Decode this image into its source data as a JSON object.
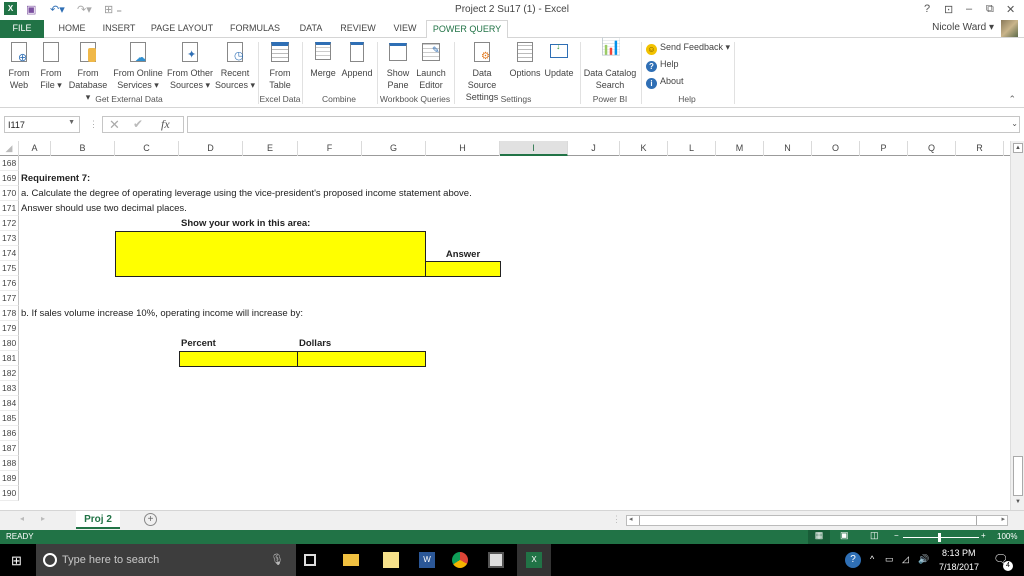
{
  "window": {
    "title": "Project 2 Su17 (1) - Excel",
    "user": "Nicole Ward",
    "controls": [
      "?",
      "ribbon-display",
      "minimize",
      "restore",
      "close"
    ]
  },
  "tabs": [
    {
      "label": "FILE"
    },
    {
      "label": "HOME"
    },
    {
      "label": "INSERT"
    },
    {
      "label": "PAGE LAYOUT"
    },
    {
      "label": "FORMULAS"
    },
    {
      "label": "DATA"
    },
    {
      "label": "REVIEW"
    },
    {
      "label": "VIEW"
    },
    {
      "label": "POWER QUERY",
      "active": true
    }
  ],
  "ribbon": {
    "buttons": [
      {
        "line1": "From",
        "line2": "Web"
      },
      {
        "line1": "From",
        "line2": "File ▾"
      },
      {
        "line1": "From",
        "line2": "Database ▾"
      },
      {
        "line1": "From Online",
        "line2": "Services ▾"
      },
      {
        "line1": "From Other",
        "line2": "Sources ▾"
      },
      {
        "line1": "Recent",
        "line2": "Sources ▾"
      },
      {
        "line1": "From",
        "line2": "Table"
      },
      {
        "line1": "Merge",
        "line2": ""
      },
      {
        "line1": "Append",
        "line2": ""
      },
      {
        "line1": "Show",
        "line2": "Pane"
      },
      {
        "line1": "Launch",
        "line2": "Editor"
      },
      {
        "line1": "Data Source",
        "line2": "Settings"
      },
      {
        "line1": "Options",
        "line2": ""
      },
      {
        "line1": "Update",
        "line2": ""
      },
      {
        "line1": "Data Catalog",
        "line2": "Search"
      }
    ],
    "groups": [
      "Get External Data",
      "Excel Data",
      "Combine",
      "Workbook Queries",
      "Settings",
      "Power BI",
      "Help"
    ],
    "help_items": [
      "Send Feedback ▾",
      "Help",
      "About"
    ]
  },
  "formula_bar": {
    "name_box": "I117",
    "formula": ""
  },
  "columns": [
    "A",
    "B",
    "C",
    "D",
    "E",
    "F",
    "G",
    "H",
    "I",
    "J",
    "K",
    "L",
    "M",
    "N",
    "O",
    "P",
    "Q",
    "R"
  ],
  "selected_column": "I",
  "rows": [
    "168",
    "169",
    "170",
    "171",
    "172",
    "173",
    "174",
    "175",
    "176",
    "177",
    "178",
    "179",
    "180",
    "181",
    "182",
    "183",
    "184",
    "185",
    "186",
    "187",
    "188",
    "189",
    "190"
  ],
  "cells": {
    "r169": "Requirement 7:",
    "r170": "a.  Calculate the degree of operating leverage using the vice-president's proposed income statement above.",
    "r171": "Answer should use two decimal places.",
    "r172": "Show your work in this area:",
    "answer_label": "Answer",
    "r178": "b.  If sales volume increase 10%, operating income will increase by:",
    "percent_label": "Percent",
    "dollars_label": "Dollars"
  },
  "sheet_tabs": [
    {
      "label": "Proj 2",
      "active": true
    }
  ],
  "status": {
    "mode": "READY",
    "zoom": "100%"
  },
  "taskbar": {
    "search_placeholder": "Type here to search",
    "time": "8:13 PM",
    "date": "7/18/2017",
    "notifications": "4"
  },
  "colors": {
    "excel_green": "#217346",
    "highlight_yellow": "#ffff00"
  }
}
